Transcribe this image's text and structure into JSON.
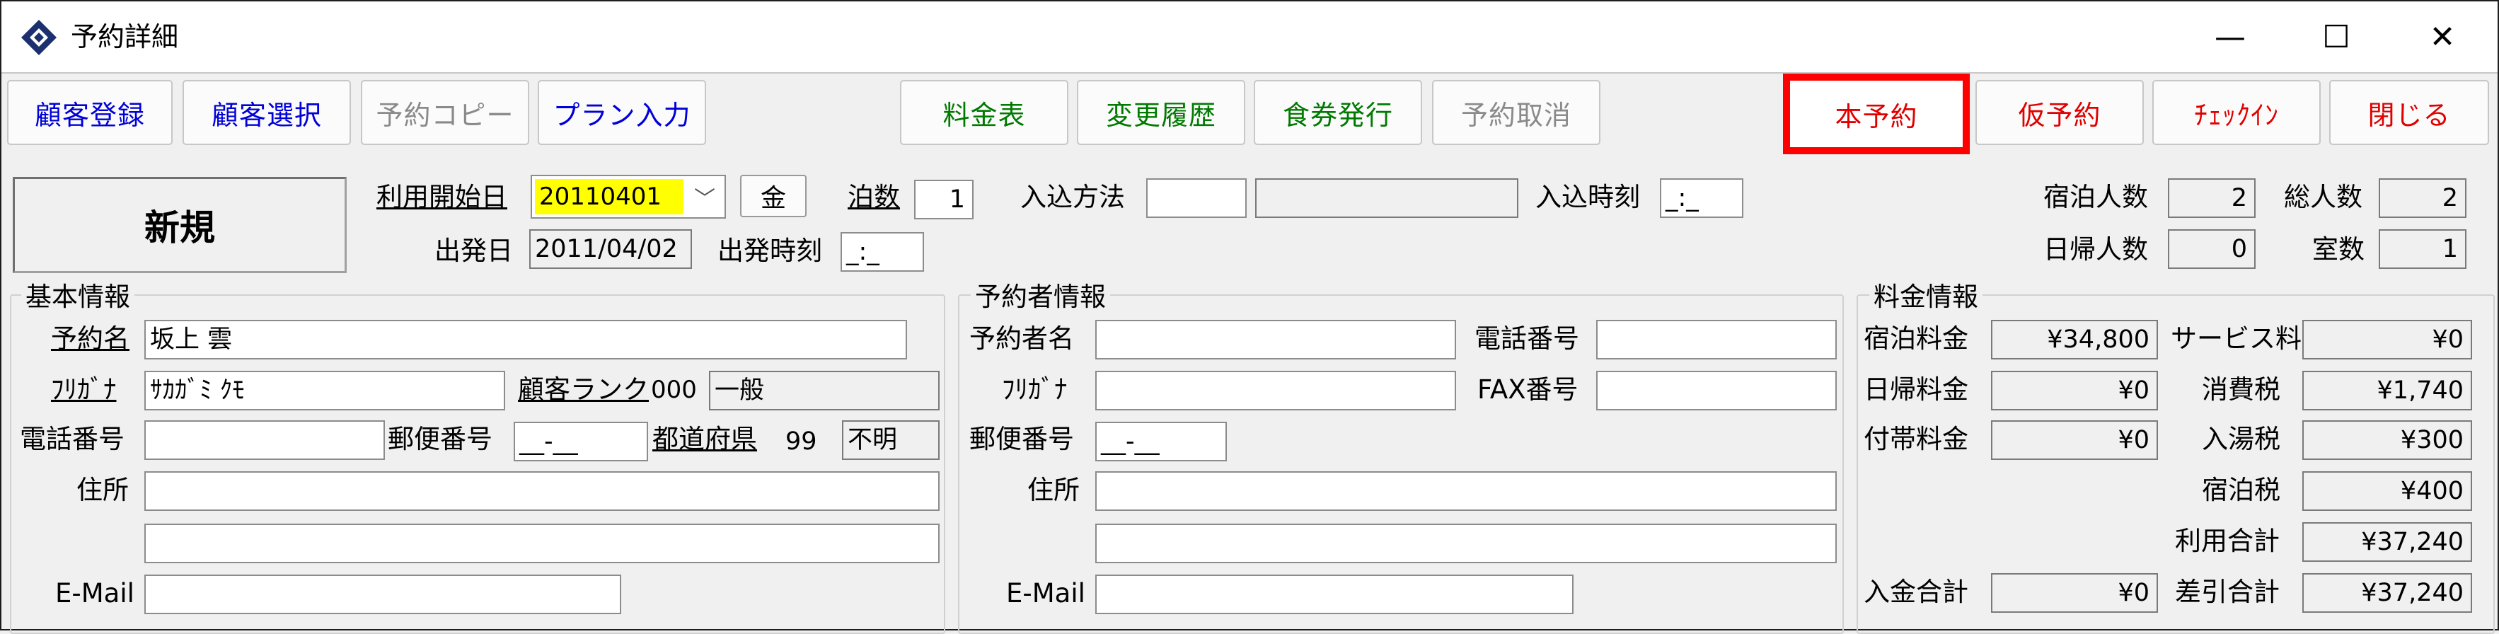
{
  "window": {
    "title": "予約詳細",
    "minimize": "—",
    "maximize": "☐",
    "close": "✕"
  },
  "toolbar": {
    "left": [
      "顧客登録",
      "顧客選択",
      "予約コピー",
      "プラン入力"
    ],
    "middle": [
      "料金表",
      "変更履歴",
      "食券発行",
      "予約取消"
    ],
    "right": [
      "本予約",
      "仮予約",
      "ﾁｪｯｸｲﾝ",
      "閉じる"
    ]
  },
  "header": {
    "status": "新規",
    "start_date_label": "利用開始日",
    "start_date_value": "20110401",
    "weekday_button": "金",
    "nights_label": "泊数",
    "nights_value": "1",
    "checkin_method_label": "入込方法",
    "checkin_method_value": "",
    "checkin_method_desc": "",
    "checkin_time_label": "入込時刻",
    "checkin_time_value": "_:_",
    "departure_date_label": "出発日",
    "departure_date_value": "2011/04/02",
    "departure_time_label": "出発時刻",
    "departure_time_value": "_:_",
    "stay_guests_label": "宿泊人数",
    "stay_guests_value": "2",
    "total_guests_label": "総人数",
    "total_guests_value": "2",
    "day_guests_label": "日帰人数",
    "day_guests_value": "0",
    "rooms_label": "室数",
    "rooms_value": "1"
  },
  "basic_info": {
    "title": "基本情報",
    "name_label": "予約名",
    "name_value": "坂上 雲",
    "kana_label": "ﾌﾘｶﾞﾅ",
    "kana_value": "ｻｶｶﾞﾐ ｸﾓ",
    "rank_label": "顧客ランク",
    "rank_code": "000",
    "rank_name": "一般",
    "phone_label": "電話番号",
    "phone_value": "",
    "postal_label": "郵便番号",
    "postal_value": "__-__",
    "pref_label": "都道府県",
    "pref_code": "99",
    "pref_name": "不明",
    "address_label": "住所",
    "address1": "",
    "address2": "",
    "email_label": "E-Mail",
    "email_value": ""
  },
  "booker_info": {
    "title": "予約者情報",
    "name_label": "予約者名",
    "name_value": "",
    "phone_label": "電話番号",
    "phone_value": "",
    "kana_label": "ﾌﾘｶﾞﾅ",
    "kana_value": "",
    "fax_label": "FAX番号",
    "fax_value": "",
    "postal_label": "郵便番号",
    "postal_value": "__-__",
    "address_label": "住所",
    "address1": "",
    "address2": "",
    "email_label": "E-Mail",
    "email_value": ""
  },
  "fee_info": {
    "title": "料金情報",
    "stay_fee_label": "宿泊料金",
    "stay_fee": "¥34,800",
    "service_label": "サービス料",
    "service": "¥0",
    "day_fee_label": "日帰料金",
    "day_fee": "¥0",
    "tax_label": "消費税",
    "tax": "¥1,740",
    "extra_fee_label": "付帯料金",
    "extra_fee": "¥0",
    "bath_tax_label": "入湯税",
    "bath_tax": "¥300",
    "lodging_tax_label": "宿泊税",
    "lodging_tax": "¥400",
    "usage_total_label": "利用合計",
    "usage_total": "¥37,240",
    "paid_label": "入金合計",
    "paid": "¥0",
    "balance_label": "差引合計",
    "balance": "¥37,240"
  }
}
